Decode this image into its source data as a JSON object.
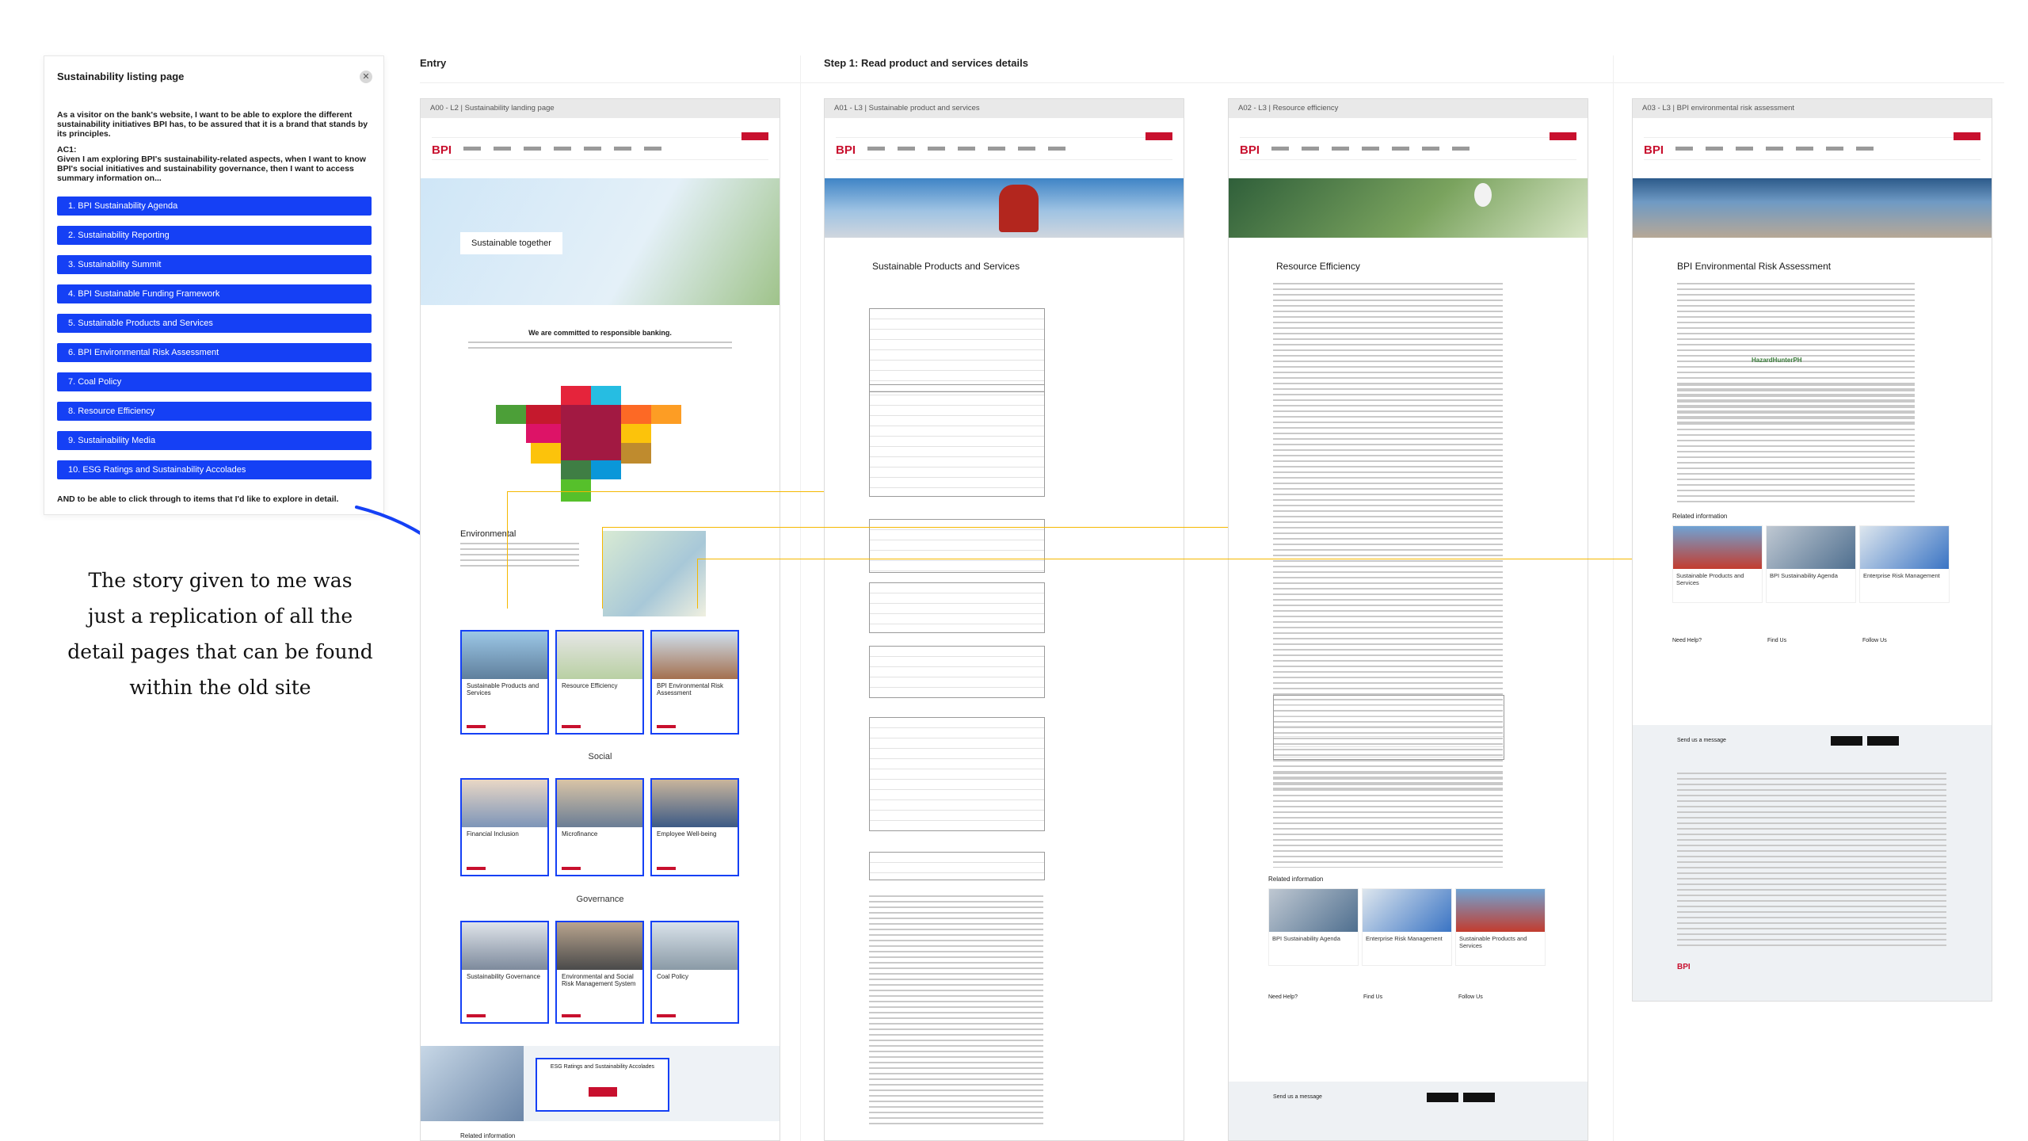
{
  "story": {
    "title": "Sustainability listing page",
    "close_icon": "close-icon",
    "intro": "As a visitor on the bank's website, I want to be able to explore the different sustainability initiatives BPI has, to be assured that it is a brand that stands by its principles.",
    "ac_label": "AC1:",
    "ac_text": "Given I am exploring BPI's sustainability-related aspects, when I want to know BPI's social initiatives and sustainability governance, then I want to access summary information on...",
    "items": [
      "1. BPI Sustainability Agenda",
      "2. Sustainability Reporting",
      "3. Sustainability Summit",
      "4. BPI Sustainable Funding Framework",
      "5. Sustainable Products and Services",
      "6. BPI Environmental Risk Assessment",
      "7. Coal Policy",
      "8. Resource Efficiency",
      "9. Sustainability Media",
      "10. ESG Ratings and Sustainability Accolades"
    ],
    "outro": "AND to be able to click through to items that I'd like to explore in detail."
  },
  "note": {
    "line1": "The story given to me was",
    "line2": "just a replication of all the",
    "line3": "detail pages that can be found",
    "line4": "within the old site"
  },
  "columns": {
    "entry": "Entry",
    "step1": "Step 1: Read product and services details"
  },
  "frames": {
    "f0": {
      "header": "A00 - L2 | Sustainability landing page",
      "hero_text": "Sustainable together",
      "commit": "We are committed to responsible banking.",
      "env_title": "Environmental",
      "social_title": "Social",
      "gov_title": "Governance",
      "env_tiles": [
        "Sustainable Products and Services",
        "Resource Efficiency",
        "BPI Environmental Risk Assessment"
      ],
      "social_tiles": [
        "Financial Inclusion",
        "Microfinance",
        "Employee Well-being"
      ],
      "gov_tiles": [
        "Sustainability Governance",
        "Environmental and Social Risk Management System",
        "Coal Policy"
      ],
      "esg_box": "ESG Ratings and Sustainability Accolades",
      "related": "Related information"
    },
    "f1": {
      "header": "A01 - L3 | Sustainable product and services",
      "title": "Sustainable Products and Services"
    },
    "f2": {
      "header": "A02 - L3 | Resource efficiency",
      "title": "Resource Efficiency",
      "related": "Related information",
      "cards": [
        "BPI Sustainability Agenda",
        "Enterprise Risk Management",
        "Sustainable Products and Services"
      ],
      "help": "Need Help?",
      "find": "Find Us",
      "follow": "Follow Us",
      "message": "Send us a message"
    },
    "f3": {
      "header": "A03 - L3 | BPI environmental risk assessment",
      "title": "BPI Environmental Risk Assessment",
      "hazard_logo": "HazardHunterPH",
      "related": "Related information",
      "cards": [
        "Sustainable Products and Services",
        "BPI Sustainability Agenda",
        "Enterprise Risk Management"
      ],
      "help": "Need Help?",
      "find": "Find Us",
      "follow": "Follow Us",
      "message": "Send us a message"
    }
  },
  "logo_text": "BPI",
  "colors": {
    "accent": "#1540f5",
    "brand": "#c8102e",
    "connector": "#f5b800"
  }
}
